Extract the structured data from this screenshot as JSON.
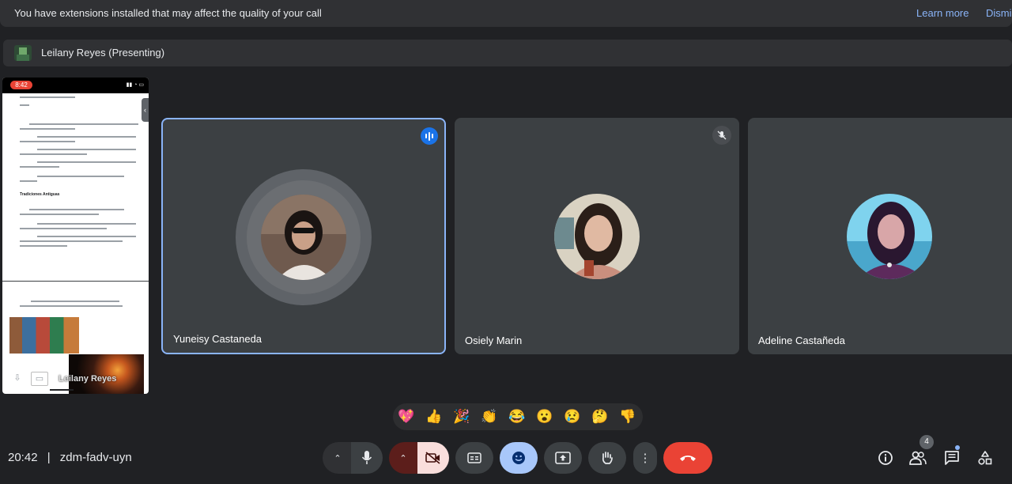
{
  "banner": {
    "message": "You have extensions installed that may affect the quality of your call",
    "learn_more": "Learn more",
    "dismiss": "Dismi"
  },
  "presenter": {
    "label": "Leilany Reyes (Presenting)"
  },
  "presentation": {
    "phone_time": "8:42",
    "heading": "Tradiciones Antiguas",
    "self_view_name": "Leilany Reyes"
  },
  "participants": [
    {
      "name": "Yuneisy Castaneda",
      "state": "speaking"
    },
    {
      "name": "Osiely Marin",
      "state": "muted"
    },
    {
      "name": "Adeline Castañeda",
      "state": "normal"
    }
  ],
  "reactions": [
    "💖",
    "👍",
    "🎉",
    "👏",
    "😂",
    "😮",
    "😢",
    "🤔",
    "👎"
  ],
  "meeting": {
    "time": "20:42",
    "separator": "|",
    "code": "zdm-fadv-uyn"
  },
  "controls": {
    "caret": "⌃",
    "more": "⋮"
  },
  "people_count": "4",
  "colors": {
    "background": "#202124",
    "tile": "#3c4043",
    "accent": "#8ab4f8",
    "end_call": "#ea4335",
    "camera_off": "#f9dedc"
  }
}
